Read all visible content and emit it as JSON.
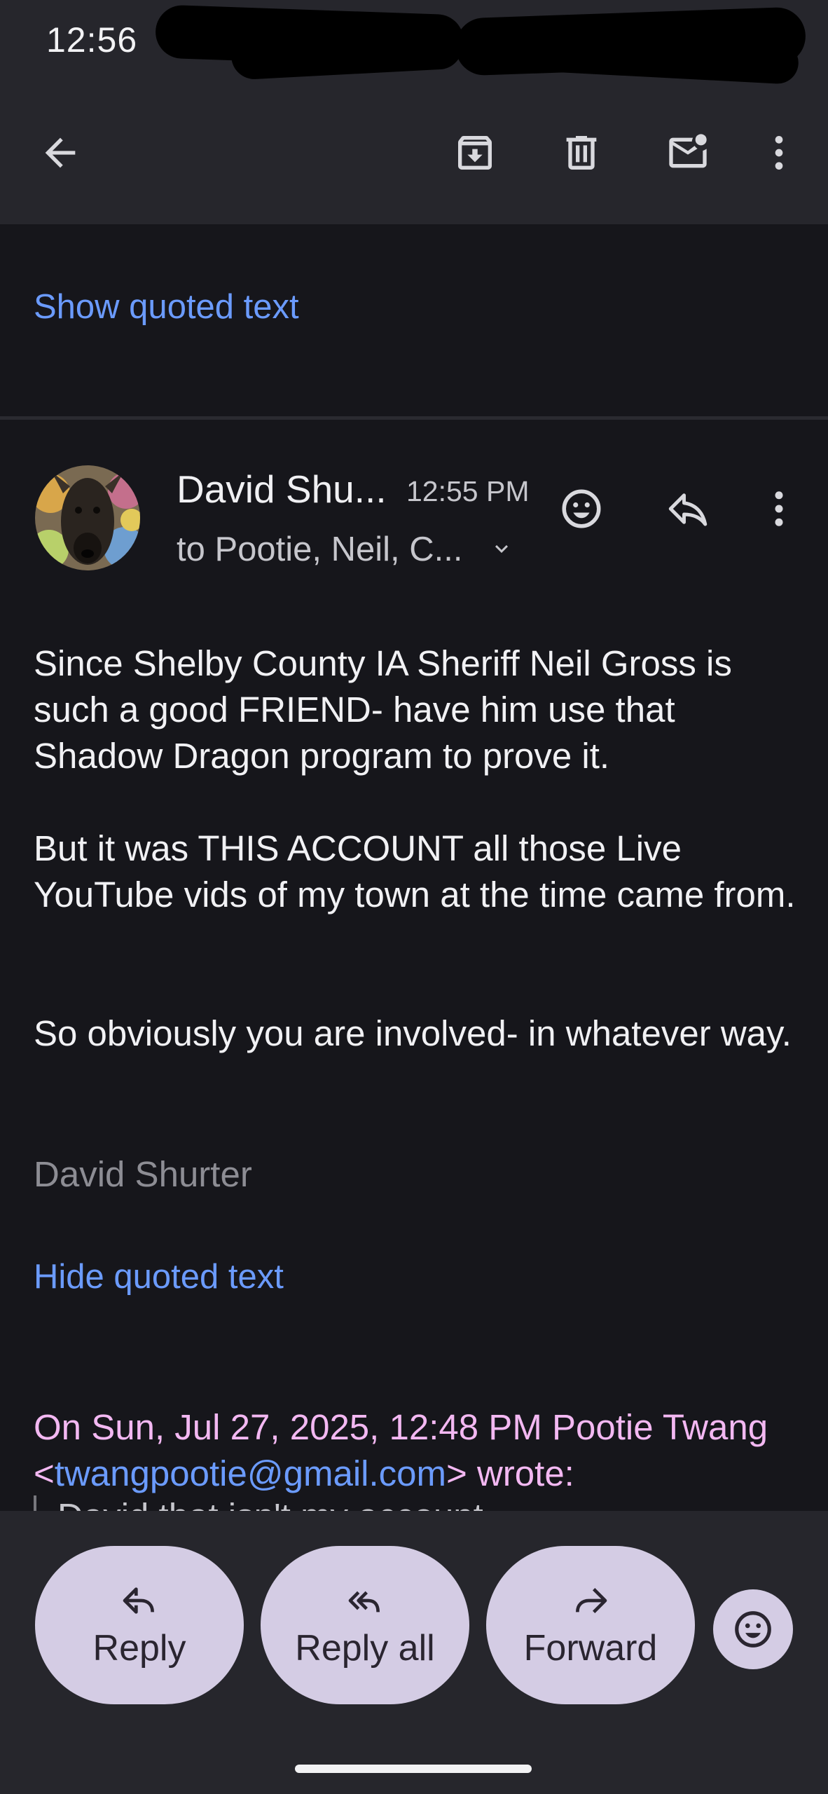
{
  "status_bar": {
    "time": "12:56"
  },
  "toolbar": {
    "icons": [
      "back-arrow-icon",
      "archive-icon",
      "delete-icon",
      "mark-unread-icon",
      "more-vert-icon"
    ]
  },
  "thread": {
    "show_quoted_label": "Show quoted text"
  },
  "message": {
    "sender": "David Shu...",
    "time": "12:55 PM",
    "recipients": "to Pootie, Neil, C...",
    "body": [
      "Since Shelby County IA Sheriff Neil Gross is such a good FRIEND- have him use that Shadow Dragon program to prove it.",
      "But it was THIS ACCOUNT all those Live YouTube vids of my town at the time came from.",
      "So obviously you are involved- in whatever way."
    ],
    "signature": "David Shurter",
    "hide_quoted_label": "Hide quoted text",
    "quote_header_prefix": "On Sun, Jul 27, 2025, 12:48 PM Pootie Twang <",
    "quote_email": "twangpootie@gmail.com",
    "quote_header_suffix": "> wrote:",
    "quote_first_line": "David that isn't my account..."
  },
  "actions": {
    "reply": "Reply",
    "reply_all": "Reply all",
    "forward": "Forward"
  }
}
